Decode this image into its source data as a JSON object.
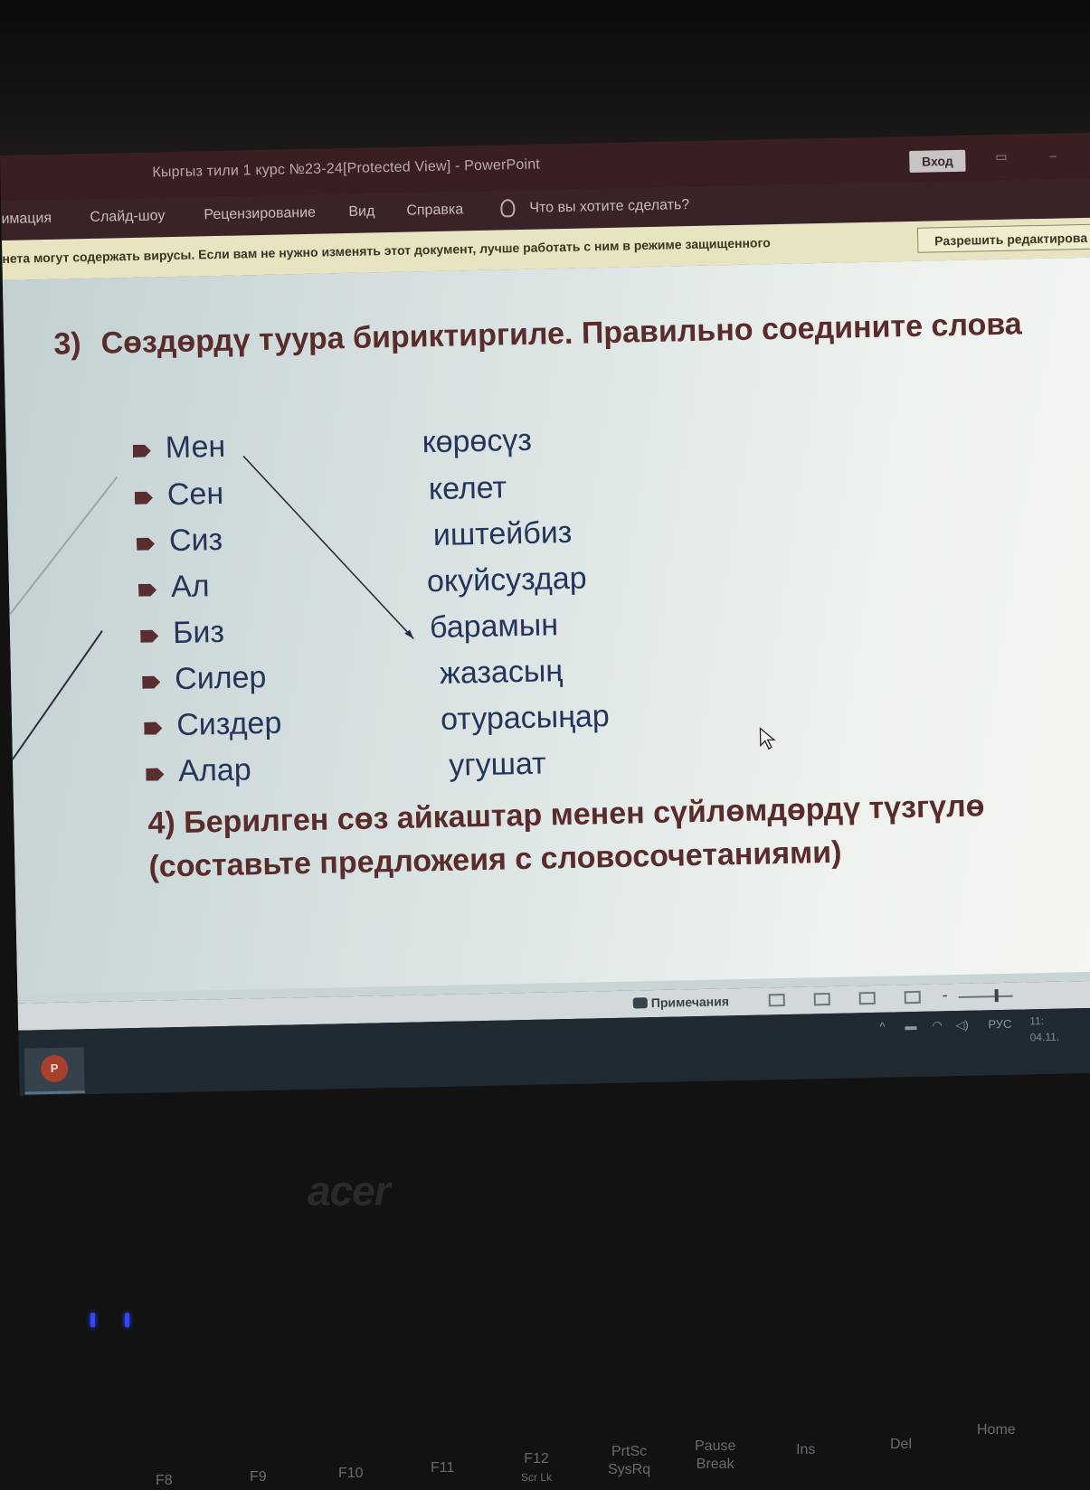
{
  "window": {
    "title": "Кыргыз тили 1 курс №23-24[Protected View]  -  PowerPoint",
    "signin_label": "Вход"
  },
  "ribbon": {
    "tabs": [
      "имация",
      "Слайд-шоу",
      "Рецензирование",
      "Вид",
      "Справка"
    ],
    "tell_me_placeholder": "Что вы хотите сделать?"
  },
  "protected_view": {
    "message": "нета могут содержать вирусы. Если вам не нужно изменять этот документ, лучше работать с ним в режиме защищенного",
    "enable_label": "Разрешить редактирова"
  },
  "slide": {
    "task3_number": "3)",
    "task3_text": "Сөздөрдү туура бириктиргиле. Правильно соедините слова",
    "pronouns": [
      "Мен",
      "Сен",
      "Сиз",
      "Ал",
      "Биз",
      "Силер",
      "Сиздер",
      "Алар"
    ],
    "verbs": [
      "көрөсүз",
      "келет",
      "иштейбиз",
      "окуйсуздар",
      "барамын",
      "жазасың",
      "отурасыңар",
      "угушат"
    ],
    "task4_text": "4) Берилген сөз айкаштар менен сүйлөмдөрдү түзгүлө (составьте предложеия с словосочетаниями)"
  },
  "statusbar": {
    "notes_label": "Примечания"
  },
  "taskbar": {
    "language": "РУС",
    "time": "11:",
    "date": "04.11."
  },
  "laptop": {
    "brand": "acer",
    "keys": [
      {
        "label": "F8"
      },
      {
        "label": "F9"
      },
      {
        "label": "F10"
      },
      {
        "label": "F11"
      },
      {
        "label": "F12",
        "sub": "Scr Lk"
      },
      {
        "label": "PrtSc",
        "sub": "SysRq"
      },
      {
        "label": "Pause",
        "sub": "Break"
      },
      {
        "label": "Ins"
      },
      {
        "label": "Del"
      },
      {
        "label": "Home"
      }
    ]
  }
}
